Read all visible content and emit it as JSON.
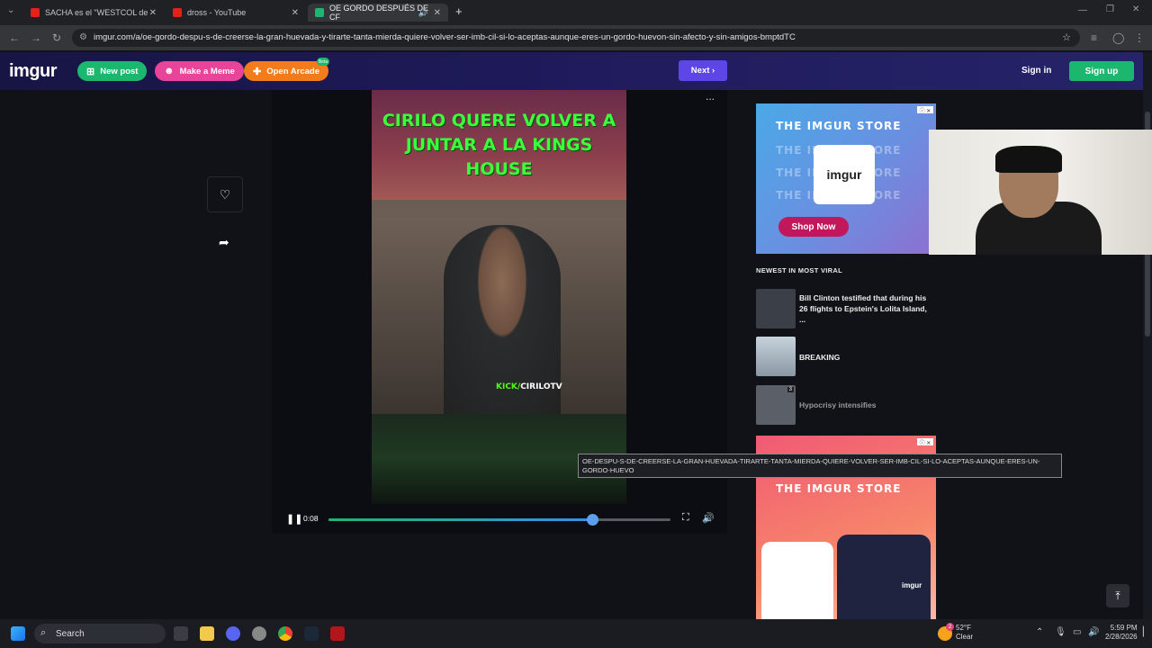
{
  "browser": {
    "tabs": [
      {
        "title": "SACHA es el \"WESTCOL de",
        "favicon_color": "#e62117"
      },
      {
        "title": "dross - YouTube",
        "favicon_color": "#e62117"
      },
      {
        "title": "OE GORDO DESPUÉS DE CF",
        "favicon_color": "#1bb76e"
      }
    ],
    "new_tab": "+",
    "url": "imgur.com/a/oe-gordo-despu-s-de-creerse-la-gran-huevada-y-tirarte-tanta-mierda-quiere-volver-ser-imb-cil-si-lo-aceptas-aunque-eres-un-gordo-huevon-sin-afecto-y-sin-amigos-bmptdTC"
  },
  "imgur_header": {
    "logo": "imgur",
    "new_post": "New post",
    "make_meme": "Make a Meme",
    "open_arcade": "Open Arcade",
    "arcade_badge": "Beta",
    "next": "Next",
    "sign_in": "Sign in",
    "sign_up": "Sign up"
  },
  "video": {
    "title_overlay": "CIRILO QUERE VOLVER A JUNTAR A LA KINGS HOUSE",
    "watermark_kick": "KICK/",
    "watermark_name": "CIRILOTV",
    "time": "0:08",
    "progress": 0.77,
    "more_menu": "..."
  },
  "sidebar": {
    "ad1": {
      "headline": "THE IMGUR STORE",
      "cta": "Shop Now",
      "mug_text": "imgur"
    },
    "newest_label": "NEWEST IN MOST VIRAL",
    "viral_posts": [
      {
        "title": "Bill Clinton testified that during his 26 flights to Epstein's Lolita Island, ...",
        "thumb_color": "#3b3f48"
      },
      {
        "title": "BREAKING",
        "thumb_color": "#8fa2b0"
      },
      {
        "title": "Hypocrisy intensifies",
        "thumb_color": "#5a5f68",
        "badge": "3"
      }
    ],
    "ad2": {
      "headline": "THE IMGUR STORE",
      "shirt_text": "imgur"
    }
  },
  "tooltip": "OE-DESPU-S-DE-CREERSE-LA-GRAN-HUEVADA-TIRARTE-TANTA-MIERDA-QUIERE-VOLVER-SER-IMB-CIL-SI-LO-ACEPTAS-AUNQUE-ERES-UN-GORDO-HUEVO",
  "taskbar": {
    "search": "Search",
    "weather_temp": "52°F",
    "weather_cond": "Clear",
    "weather_badge": "2",
    "time": "5:59 PM",
    "date": "2/28/2026"
  }
}
